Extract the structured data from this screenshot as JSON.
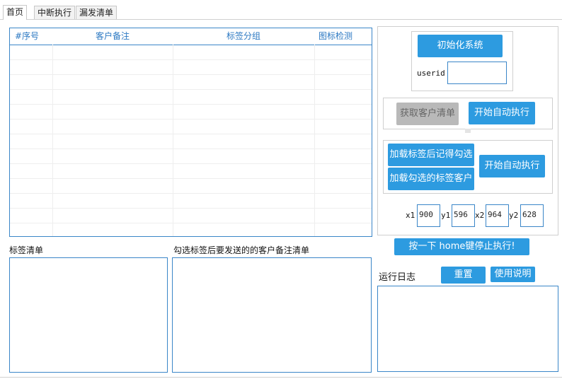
{
  "tabs": [
    "首页",
    "中断执行",
    "漏发清单"
  ],
  "grid": {
    "columns": [
      "#序号",
      "客户备注",
      "标签分组",
      "图标检测"
    ],
    "rows": []
  },
  "labels": {
    "tag_list": "标签清单",
    "remark_list": "勾选标签后要发送的的客户备注清单",
    "run_log": "运行日志",
    "userid": "userid",
    "x1": "x1",
    "y1": "y1",
    "x2": "x2",
    "y2": "y2"
  },
  "buttons": {
    "init": "初始化系统",
    "get_clients": "获取客户清单",
    "auto_exec_1": "开始自动执行",
    "load_tags_remember": "加载标签后记得勾选",
    "load_checked_tags": "加载勾选的标签客户",
    "auto_exec_2": "开始自动执行",
    "press_home": "按一下 home键停止执行!",
    "reset": "重置",
    "help": "使用说明"
  },
  "inputs": {
    "userid": "",
    "x1": "900",
    "y1": "596",
    "x2": "964",
    "y2": "628"
  },
  "colors": {
    "accent": "#2d9be0",
    "border": "#3a86c8",
    "disabled": "#b9b9b9"
  }
}
